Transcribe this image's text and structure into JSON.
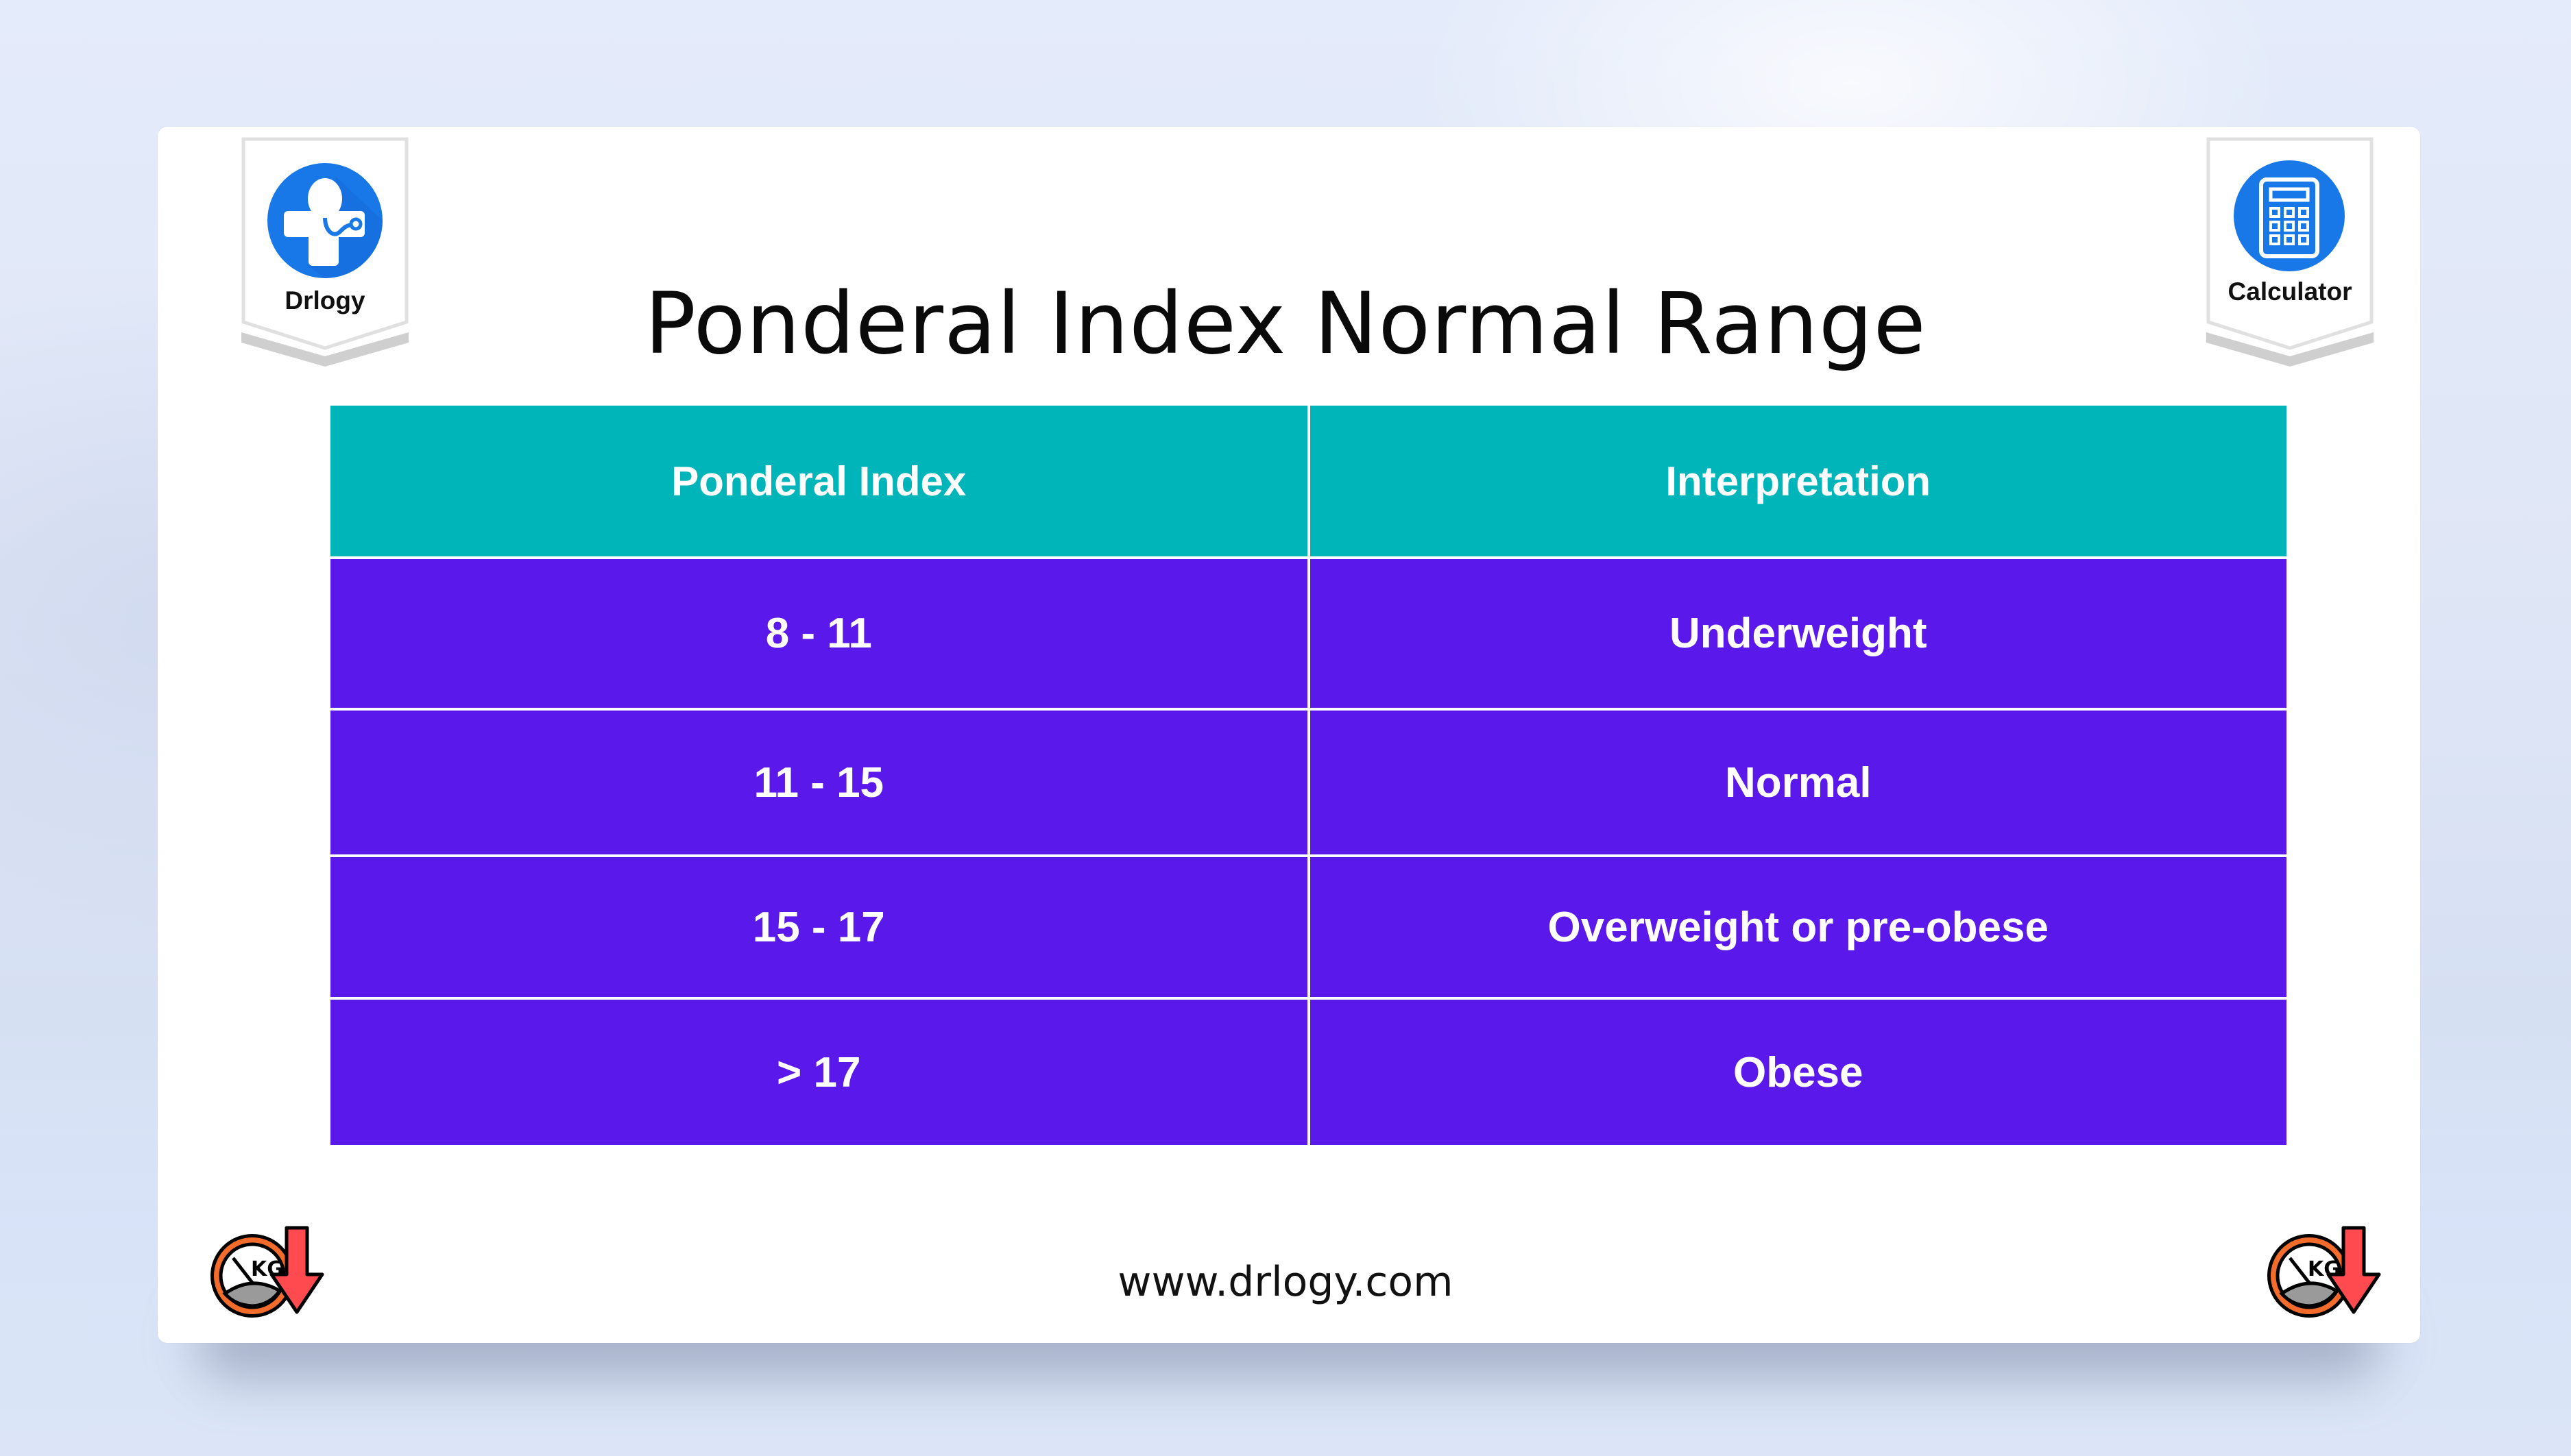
{
  "page": {
    "title": "Ponderal Index Normal Range",
    "footer_url": "www.drlogy.com"
  },
  "badges": {
    "left": {
      "label": "Drlogy",
      "icon": "stethoscope-cross-icon"
    },
    "right": {
      "label": "Calculator",
      "icon": "calculator-icon"
    }
  },
  "corner_icons": {
    "icon": "kg-weight-loss-icon",
    "text": "KG"
  },
  "colors": {
    "header_bg": "#00b5b9",
    "row_bg": "#5b18eb",
    "badge_blue": "#1978e8",
    "text_on_table": "#ffffff"
  },
  "table": {
    "headers": [
      "Ponderal Index",
      "Interpretation"
    ],
    "rows": [
      [
        "8 - 11",
        "Underweight"
      ],
      [
        "11 - 15",
        "Normal"
      ],
      [
        "15 - 17",
        "Overweight or pre-obese"
      ],
      [
        "> 17",
        "Obese"
      ]
    ]
  }
}
